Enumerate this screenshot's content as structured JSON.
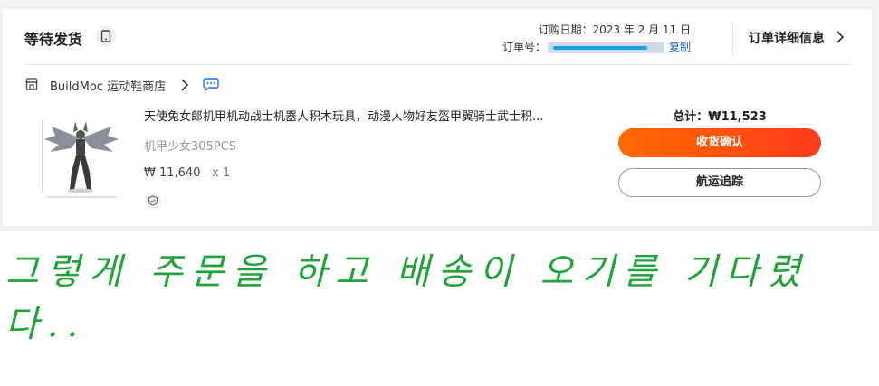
{
  "order": {
    "status": "等待发货",
    "status_icon": "phone-icon",
    "date_label": "订购日期：2023 年 2 月 11 日",
    "number_label": "订单号：",
    "copy_label": "复制",
    "details_label": "订单详细信息"
  },
  "store": {
    "name": "BuildMoc 运动鞋商店",
    "icon": "store-icon",
    "chat_icon": "chat-icon"
  },
  "item": {
    "title": "天使兔女郎机甲机动战士机器人积木玩具，动漫人物好友盔甲翼骑士武士积...",
    "variant": "机甲少女305PCS",
    "price": "₩ 11,640",
    "quantity": "x 1"
  },
  "summary": {
    "total": "总计：₩11,523",
    "confirm_button": "收货确认",
    "track_button": "航运追踪"
  },
  "caption": "그렇게 주문을 하고 배송이 오기를 기다렸다..",
  "colors": {
    "accent": "#ff4d1a",
    "link": "#1a5fd6",
    "caption": "#22a33a"
  }
}
